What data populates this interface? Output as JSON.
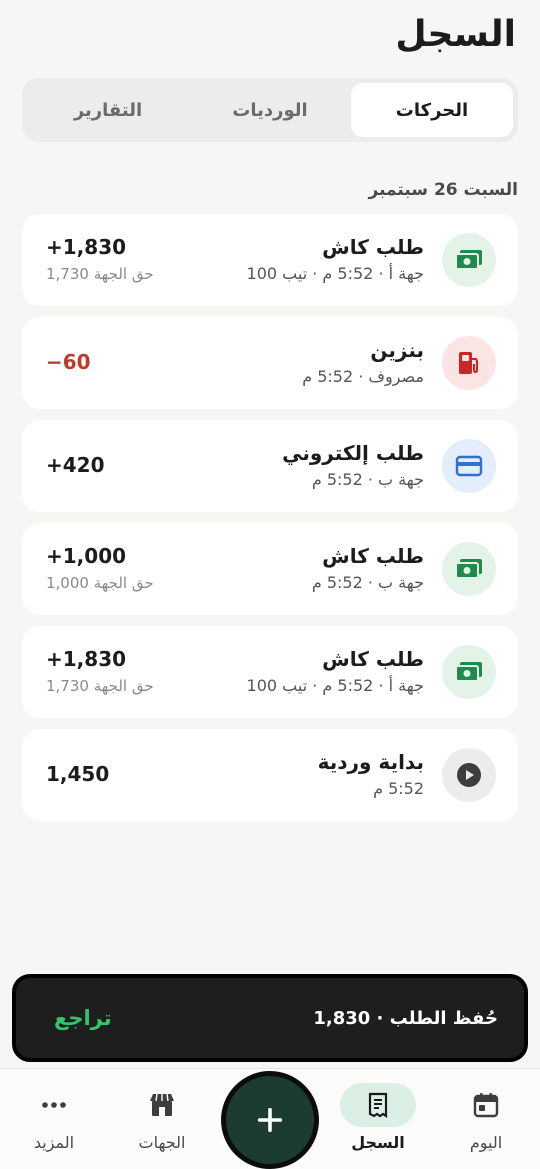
{
  "header": {
    "title": "السجل"
  },
  "tabs": [
    {
      "label": "الحركات",
      "active": true
    },
    {
      "label": "الورديات",
      "active": false
    },
    {
      "label": "التقارير",
      "active": false
    }
  ],
  "date_header": "السبت 26 سبتمبر",
  "transactions": [
    {
      "title": "طلب كاش",
      "subtitle": "جهة أ · 5:52 م · تيب 100",
      "amount": "+1,830",
      "share": "حق الجهة 1,730",
      "icon": "cash-icon",
      "type": "cash"
    },
    {
      "title": "بنزين",
      "subtitle": "مصروف · 5:52 م",
      "amount": "−60",
      "share": "",
      "icon": "fuel-icon",
      "type": "expense"
    },
    {
      "title": "طلب إلكتروني",
      "subtitle": "جهة ب · 5:52 م",
      "amount": "+420",
      "share": "",
      "icon": "card-icon",
      "type": "electronic"
    },
    {
      "title": "طلب كاش",
      "subtitle": "جهة ب · 5:52 م",
      "amount": "+1,000",
      "share": "حق الجهة 1,000",
      "icon": "cash-icon",
      "type": "cash"
    },
    {
      "title": "طلب كاش",
      "subtitle": "جهة أ · 5:52 م · تيب 100",
      "amount": "+1,830",
      "share": "حق الجهة 1,730",
      "icon": "cash-icon",
      "type": "cash"
    },
    {
      "title": "بداية وردية",
      "subtitle": "5:52 م",
      "amount": "1,450",
      "share": "",
      "icon": "play-icon",
      "type": "shift"
    }
  ],
  "snackbar": {
    "message": "حُفظ الطلب · 1,830",
    "action": "تراجع"
  },
  "nav": {
    "today": "اليوم",
    "log": "السجل",
    "entities": "الجهات",
    "more": "المزيد"
  },
  "colors": {
    "accent": "#1c3b31",
    "success": "#34c56b",
    "expense": "#c0392b",
    "cash_bg": "#e3f3e8",
    "expense_bg": "#fbe4e4",
    "card_bg": "#e3edfb"
  }
}
